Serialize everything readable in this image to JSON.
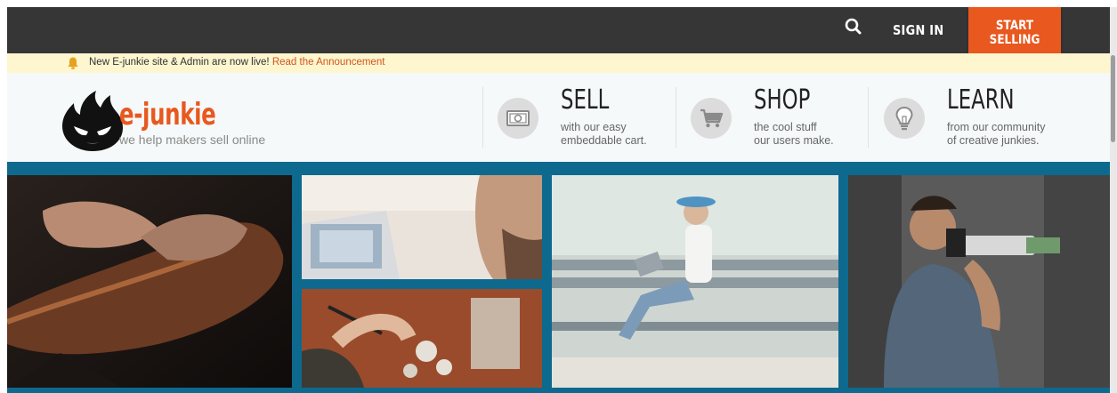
{
  "topbar": {
    "search_icon": "search-icon",
    "sign_in_label": "SIGN IN",
    "start_selling_line1": "START",
    "start_selling_line2": "SELLING",
    "accent_color": "#e8581f"
  },
  "announcement": {
    "icon": "bell-icon",
    "text": "New E-junkie site & Admin are now live!",
    "link_text": "Read the Announcement"
  },
  "logo": {
    "name": "e-junkie",
    "tagline": "we help makers sell online"
  },
  "features": [
    {
      "icon": "money-icon",
      "title": "SELL",
      "line1": "with our easy",
      "line2": "embeddable cart."
    },
    {
      "icon": "cart-icon",
      "title": "SHOP",
      "line1": "the cool stuff",
      "line2": "our users make."
    },
    {
      "icon": "lightbulb-icon",
      "title": "LEARN",
      "line1": "from our community",
      "line2": "of creative junkies."
    }
  ],
  "band_color": "#0d6a8e"
}
